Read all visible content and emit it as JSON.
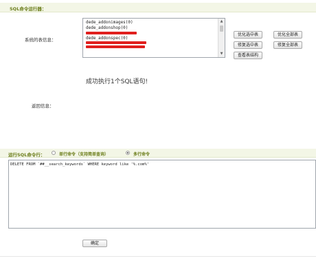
{
  "header": {
    "title": "SQL命令运行器："
  },
  "system_tables": {
    "label": "系统的表信息：",
    "items": [
      "dede_addonimages(0)",
      "dede_addonshop(0)",
      "dede_addonspec(0)"
    ]
  },
  "table_buttons": {
    "optimize_selected": "优化选中表",
    "optimize_all": "优化全部表",
    "repair_selected": "修复选中表",
    "repair_all": "修复全部表",
    "view_structure": "查看表结构"
  },
  "result": {
    "message": "成功执行1个SQL语句!",
    "label": "返回信息："
  },
  "run_sql": {
    "label": "运行SQL命令行：",
    "single_option": "单行命令（支持简单查询）",
    "multi_option": "多行命令",
    "selected": "multi",
    "query": "DELETE FROM `##__search_keywords` WHERE keyword like '%.com%'"
  },
  "submit_label": "确定",
  "colors": {
    "accent": "#6b7d1a",
    "redact": "#e0201e",
    "section_bg": "#f3f6e6"
  }
}
